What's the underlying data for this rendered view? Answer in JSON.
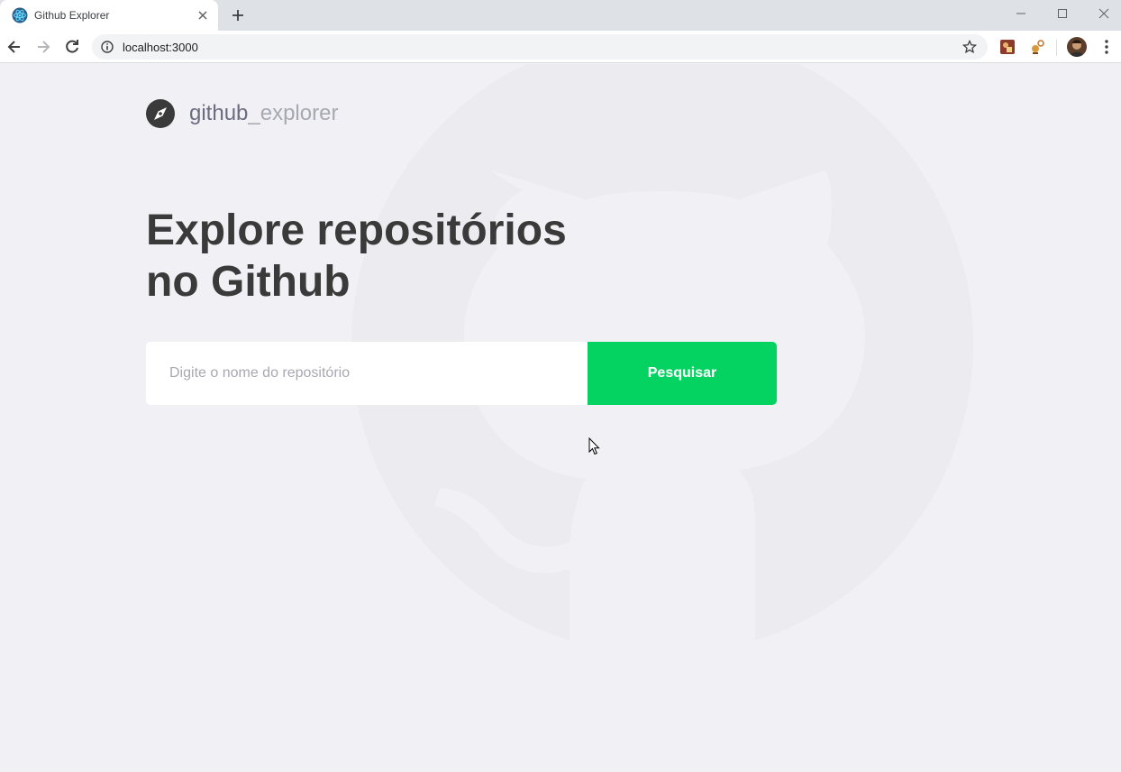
{
  "browser": {
    "tab_title": "Github Explorer",
    "url": "localhost:3000",
    "icons": {
      "favicon": "react-atom-icon",
      "close": "close-icon",
      "new_tab": "plus-icon",
      "back": "arrow-left-icon",
      "forward": "arrow-right-icon",
      "reload": "reload-icon",
      "info": "info-icon",
      "bookmark": "star-icon",
      "menu": "kebab-menu-icon"
    }
  },
  "app": {
    "brand": {
      "strong": "github",
      "light": "_explorer",
      "icon": "compass-icon"
    },
    "headline": {
      "line1": "Explore repositórios",
      "line2": "no Github"
    },
    "search": {
      "placeholder": "Digite o nome do repositório",
      "value": "",
      "button_label": "Pesquisar"
    },
    "colors": {
      "accent": "#04d361",
      "background": "#f0f0f5",
      "title": "#3a3a3a",
      "muted": "#a8a8b3"
    }
  }
}
